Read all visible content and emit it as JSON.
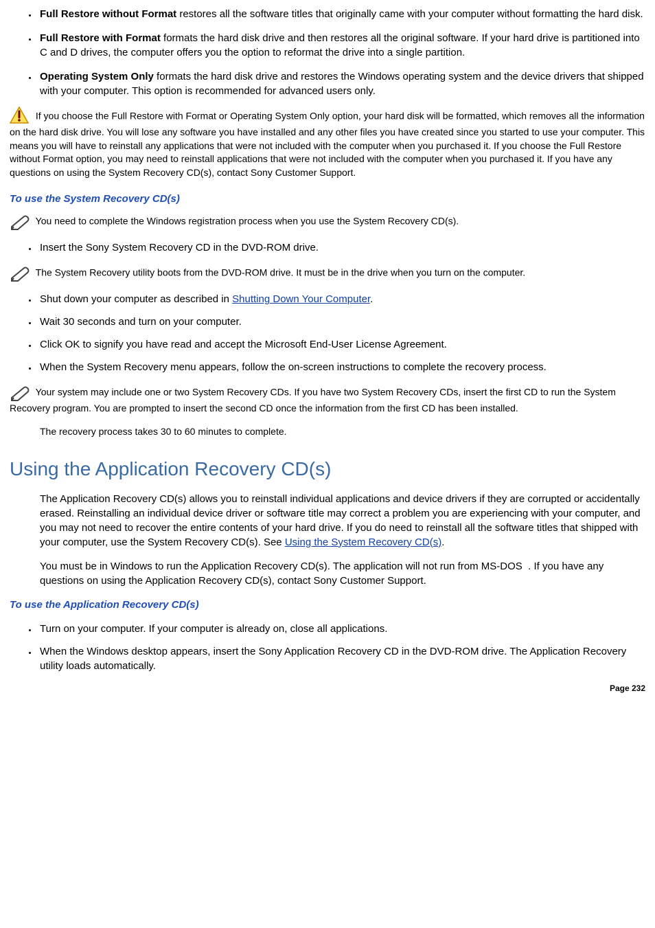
{
  "options": [
    {
      "title": "Full Restore without Format",
      "text": " restores all the software titles that originally came with your computer without formatting the hard disk."
    },
    {
      "title": "Full Restore with Format",
      "text": " formats the hard disk drive and then restores all the original software. If your hard drive is partitioned into C and D drives, the computer offers you the option to reformat the drive into a single partition."
    },
    {
      "title": "Operating System Only",
      "text": " formats the hard disk drive and restores the Windows operating system and the device drivers that shipped with your computer. This option is recommended for advanced users only."
    }
  ],
  "warning": "If you choose the Full Restore with Format or Operating System Only option, your hard disk will be formatted, which removes all the information on the hard disk drive. You will lose any software you have installed and any other files you have created since you started to use your computer. This means you will have to reinstall any applications that were not included with the computer when you purchased it. If you choose the Full Restore without Format option, you may need to reinstall applications that were not included with the computer when you purchased it. If you have any questions on using the System Recovery CD(s), contact Sony Customer Support.",
  "heading1": "To use the System Recovery CD(s)",
  "note1": "You need to complete the Windows registration process when you use the System Recovery CD(s).",
  "step1": "Insert the Sony System Recovery CD in the DVD-ROM drive.",
  "note2": "The System Recovery utility boots from the DVD-ROM drive. It must be in the drive when you turn on the computer.",
  "steps2": {
    "a_pre": "Shut down your computer as described in ",
    "a_link": "Shutting Down Your Computer",
    "a_post": ".",
    "b": "Wait 30 seconds and turn on your computer.",
    "c": "Click OK to signify you have read and accept the Microsoft End-User License Agreement.",
    "d": "When the System Recovery menu appears, follow the on-screen instructions to complete the recovery process."
  },
  "note3": "Your system may include one or two System Recovery CDs. If you have two System Recovery CDs, insert the first CD to run the System Recovery program. You are prompted to insert the second CD once the information from the first CD has been installed.",
  "recovery_time": "The recovery process takes 30 to 60 minutes to complete.",
  "section2_title": "Using the Application Recovery CD(s)",
  "section2_p1_pre": "The Application Recovery CD(s) allows you to reinstall individual applications and device drivers if they are corrupted or accidentally erased. Reinstalling an individual device driver or software title may correct a problem you are experiencing with your computer, and you may not need to recover the entire contents of your hard drive. If you do need to reinstall all the software titles that shipped with your computer, use the System Recovery CD(s). See ",
  "section2_p1_link": "Using the System Recovery CD(s)",
  "section2_p1_post": ".",
  "section2_p2": "You must be in Windows to run the Application Recovery CD(s). The application will not run from MS-DOS  . If you have any questions on using the Application Recovery CD(s), contact Sony Customer Support.",
  "heading2": "To use the Application Recovery CD(s)",
  "app_steps": {
    "a": "Turn on your computer. If your computer is already on, close all applications.",
    "b": "When the Windows desktop appears, insert the Sony Application Recovery CD in the DVD-ROM drive. The Application Recovery utility loads automatically."
  },
  "page_number": "Page 232"
}
